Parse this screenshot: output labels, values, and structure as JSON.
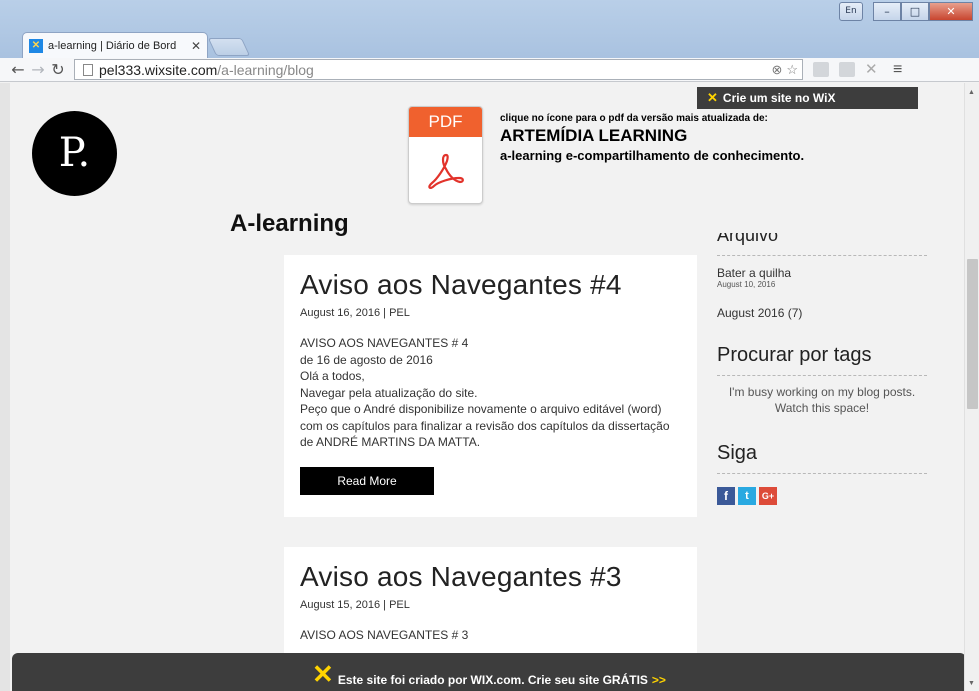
{
  "browser": {
    "tab_title": "a-learning | Diário de Bord",
    "tab_close": "✕",
    "url_host": "pel333.wixsite.com",
    "url_path": "/a-learning/blog",
    "window_buttons": {
      "ime": "En",
      "minimize": "–",
      "maximize": "□",
      "close": "✕"
    }
  },
  "wix_top": {
    "label": "Crie um site no WiX"
  },
  "logo": {
    "letter": "P."
  },
  "pdf": {
    "icon_label": "PDF",
    "caption_small": "clique no ícone para o pdf da versão mais atualizada de:",
    "caption_title": "ARTEMÍDIA LEARNING",
    "caption_sub": "a-learning e-compartilhamento de conhecimento."
  },
  "site": {
    "title": "A-learning"
  },
  "posts": [
    {
      "title": "Aviso aos Navegantes #4",
      "meta": "August 16, 2016   |  PEL",
      "body": [
        "AVISO AOS NAVEGANTES # 4",
        "de 16 de agosto de 2016",
        "Olá a todos,",
        "Navegar pela atualização do site.",
        "Peço que o André disponibilize novamente o arquivo editável (word) com os capítulos para finalizar a revisão dos capítulos da dissertação de ANDRÉ MARTINS DA MATTA."
      ],
      "read_more": "Read More"
    },
    {
      "title": "Aviso aos Navegantes #3",
      "meta": "August 15, 2016   |  PEL",
      "body": [
        "AVISO AOS NAVEGANTES # 3"
      ]
    }
  ],
  "sidebar": {
    "archive_heading": "Arquivo",
    "archive_link": "Bater a quilha",
    "archive_link_date": "August 10, 2016",
    "archive_month": "August 2016 (7)",
    "tags_heading": "Procurar por tags",
    "tags_text": "I'm busy working on my blog posts. Watch this space!",
    "follow_heading": "Siga",
    "social": {
      "facebook": "f",
      "twitter": "t",
      "googleplus": "G+"
    }
  },
  "wix_banner": {
    "text": "Este site foi criado por WIX.com. Crie seu site GRÁTIS",
    "arrow": ">>"
  }
}
